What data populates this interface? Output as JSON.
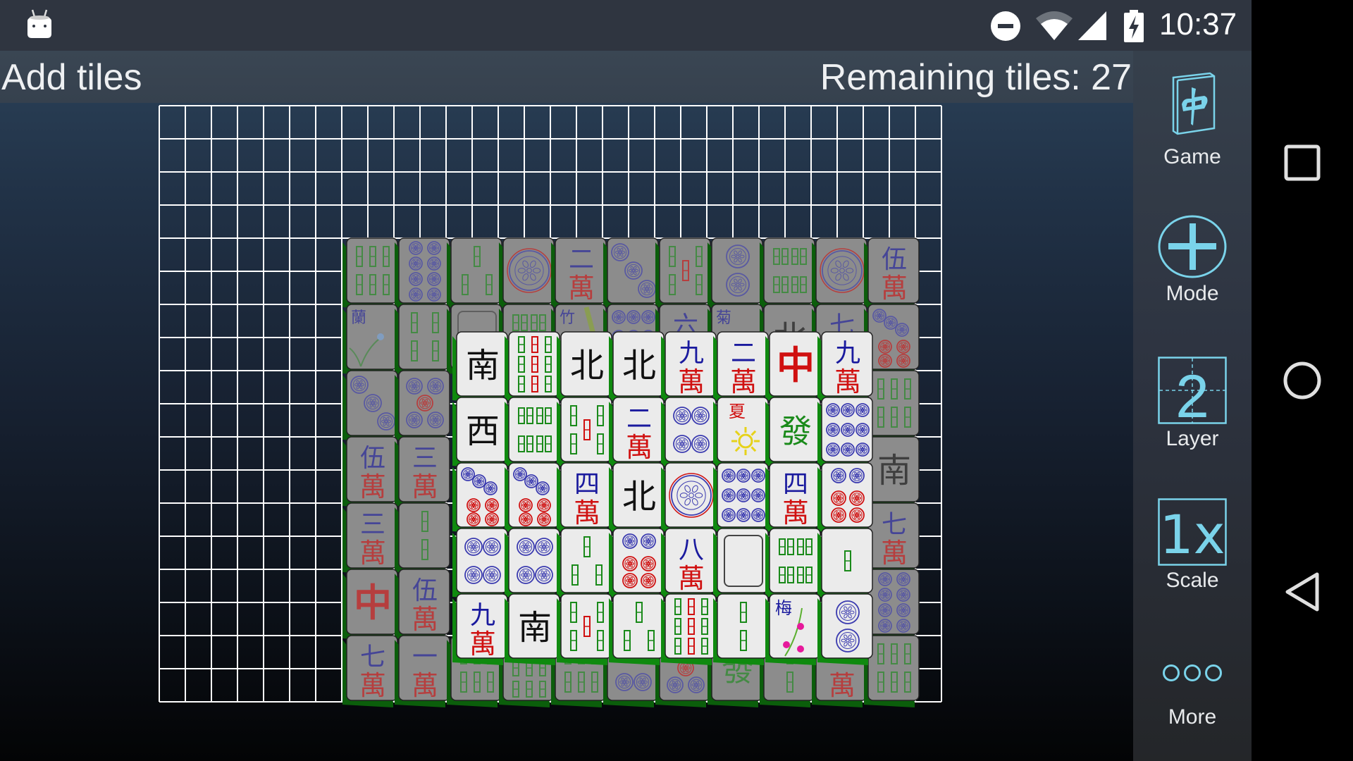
{
  "status_bar": {
    "time": "10:37",
    "icons": [
      "android-notification-icon",
      "do-not-disturb-icon",
      "wifi-icon",
      "cell-signal-icon",
      "battery-charging-icon"
    ]
  },
  "header": {
    "mode_title": "Add tiles",
    "remaining_label": "Remaining tiles: 27"
  },
  "sidebar": {
    "items": [
      {
        "label": "Game",
        "icon": "mahjong-tile-icon"
      },
      {
        "label": "Mode",
        "icon": "plus-circle-icon"
      },
      {
        "label": "Layer",
        "icon": "layer-box-icon",
        "value": "2"
      },
      {
        "label": "Scale",
        "icon": "scale-box-icon",
        "value": "1x"
      },
      {
        "label": "More",
        "icon": "more-dots-icon"
      }
    ],
    "accent": "#7ad3ea"
  },
  "nav_bar": {
    "buttons": [
      "recents-button",
      "home-button",
      "back-button"
    ]
  },
  "board": {
    "grid_cols": 30,
    "grid_rows": 18,
    "layers": [
      {
        "layer": 1,
        "cols": 11,
        "rows": 7,
        "dimmed": true,
        "tiles": [
          [
            "b6",
            "c8",
            "b3",
            "c1",
            "m2",
            "c3",
            "b5",
            "c2",
            "b8",
            "c1",
            "m5"
          ],
          [
            "f-orchid",
            "b4",
            "white",
            "b8",
            "f-bamboo",
            "c9",
            "m6",
            "f-chrys",
            "north",
            "m7",
            "c7"
          ],
          [
            "c3",
            "c5",
            "",
            "",
            "",
            "",
            "",
            "",
            "",
            "",
            "b6"
          ],
          [
            "m5",
            "m3",
            "",
            "",
            "",
            "",
            "",
            "",
            "",
            "",
            "south"
          ],
          [
            "m3",
            "b2",
            "",
            "",
            "",
            "",
            "",
            "",
            "",
            "",
            "m7"
          ],
          [
            "red",
            "m5",
            "",
            "",
            "",
            "",
            "",
            "",
            "",
            "",
            "c8"
          ],
          [
            "m7",
            "m1",
            "b6",
            "b7",
            "b6",
            "c4",
            "c5",
            "green",
            "b2",
            "m?",
            "b6"
          ]
        ]
      },
      {
        "layer": 2,
        "cols": 8,
        "rows": 5,
        "dimmed": false,
        "tiles": [
          [
            "south",
            "b9",
            "north",
            "north",
            "m9",
            "m2",
            "red",
            "m9"
          ],
          [
            "west",
            "b8",
            "b5",
            "m2",
            "c4",
            "s-summer",
            "green",
            "c9"
          ],
          [
            "c7",
            "c7",
            "m4",
            "north",
            "c1",
            "c9",
            "m4",
            "c6"
          ],
          [
            "c4",
            "c4",
            "b3",
            "c6",
            "m8",
            "white",
            "b8",
            "b1"
          ],
          [
            "m9",
            "south",
            "b5",
            "b3",
            "b9",
            "b2",
            "f-plum",
            "c2"
          ]
        ]
      }
    ]
  },
  "tile_colors": {
    "blue": "#1a1a9e",
    "red": "#d01010",
    "green": "#1a8a1a",
    "black": "#111111",
    "circle": "#3b3bb0",
    "face_top": "#ebebeb",
    "face_dim": "#8c8c8c",
    "edge": "#0f8a0f"
  }
}
